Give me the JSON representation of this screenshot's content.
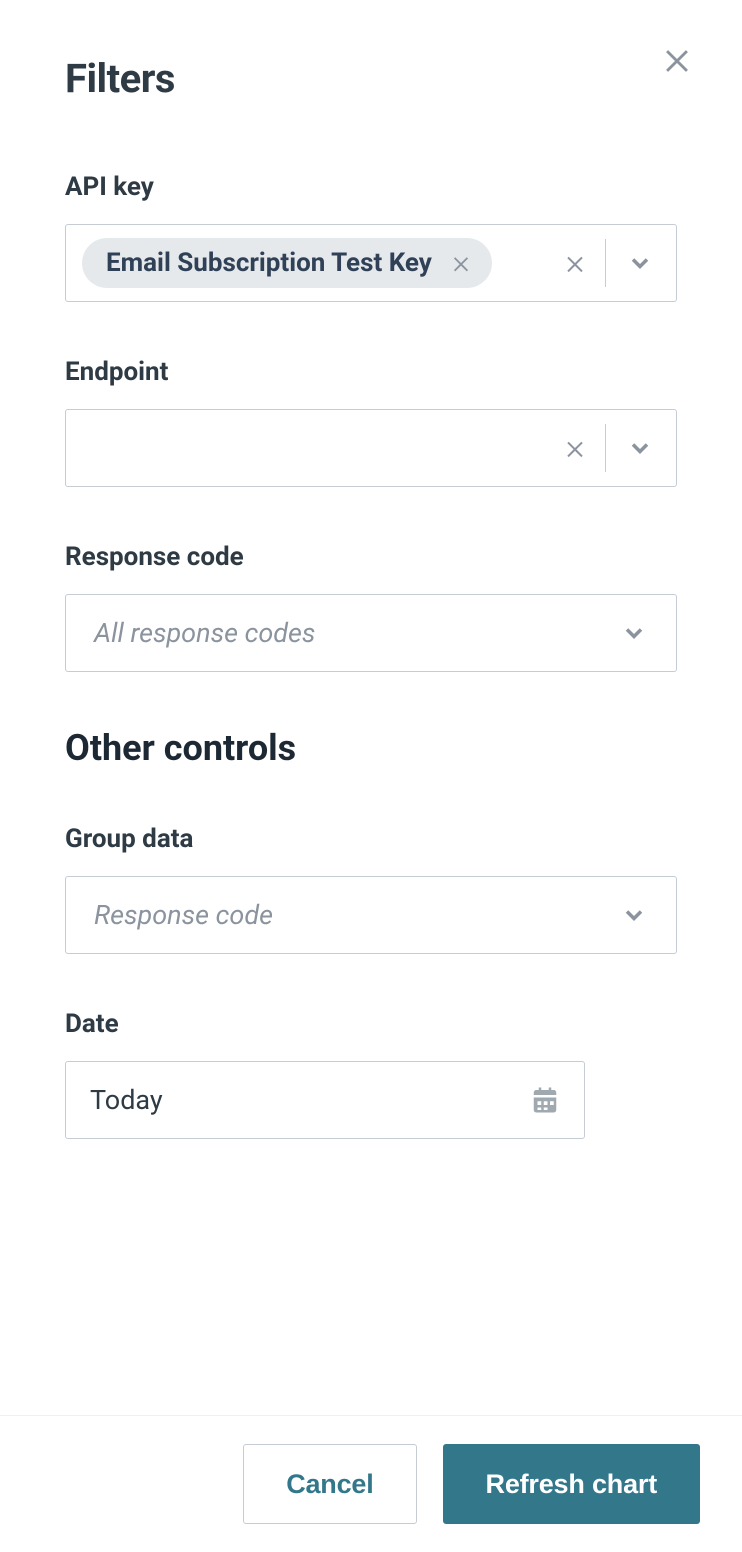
{
  "header": {
    "title": "Filters"
  },
  "filters": {
    "api_key": {
      "label": "API key",
      "selected_chip": "Email Subscription Test Key"
    },
    "endpoint": {
      "label": "Endpoint"
    },
    "response_code": {
      "label": "Response code",
      "placeholder": "All response codes"
    }
  },
  "other_header": "Other controls",
  "other": {
    "group_data": {
      "label": "Group data",
      "placeholder": "Response code"
    },
    "date": {
      "label": "Date",
      "value": "Today"
    }
  },
  "footer": {
    "cancel": "Cancel",
    "refresh": "Refresh chart"
  }
}
